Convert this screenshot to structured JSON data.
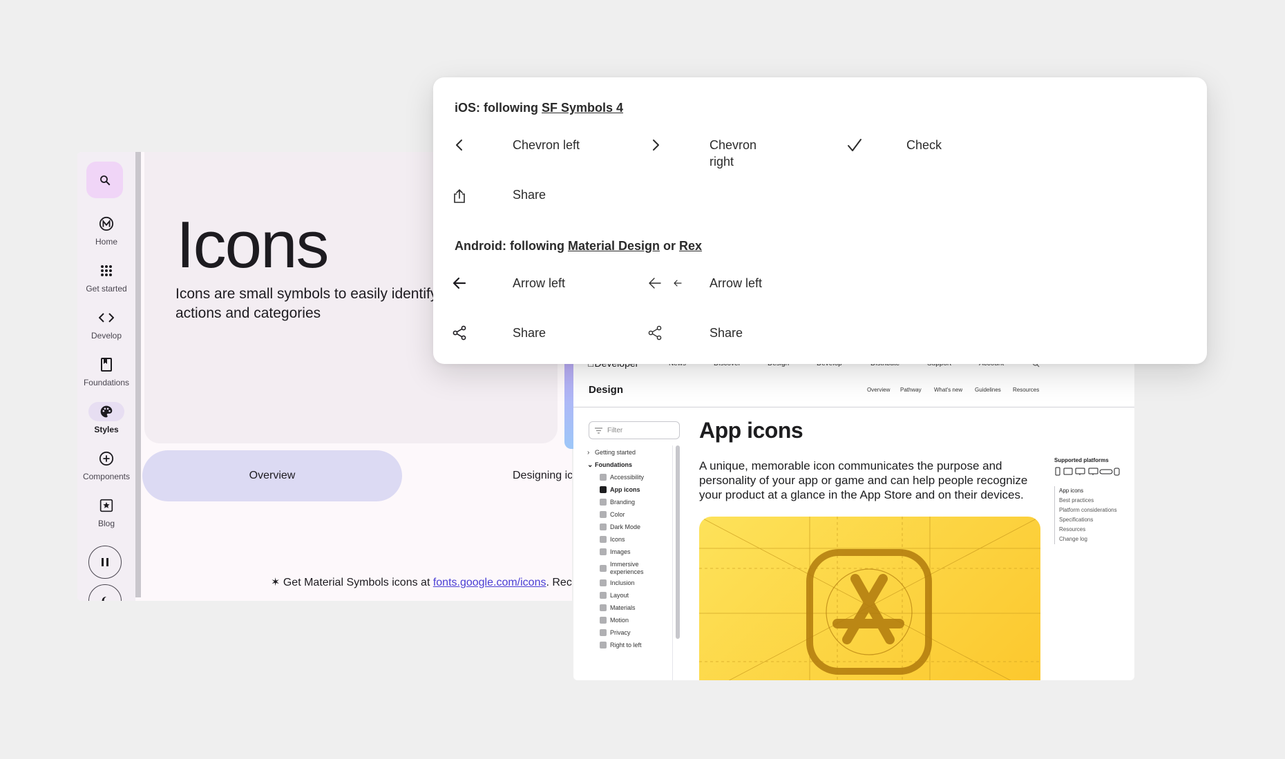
{
  "material": {
    "rail": {
      "items": [
        {
          "label": "Home",
          "icon": "material-logo-icon"
        },
        {
          "label": "Get started",
          "icon": "apps-grid-icon"
        },
        {
          "label": "Develop",
          "icon": "code-icon"
        },
        {
          "label": "Foundations",
          "icon": "book-icon"
        },
        {
          "label": "Styles",
          "icon": "palette-icon",
          "active": true
        },
        {
          "label": "Components",
          "icon": "add-circle-icon"
        },
        {
          "label": "Blog",
          "icon": "star-square-icon"
        }
      ]
    },
    "hero": {
      "title": "Icons",
      "description": "Icons are small symbols to easily identify actions and categories"
    },
    "tabs": [
      "Overview",
      "Designing icons"
    ],
    "footnote": {
      "prefix": "Get Material Symbols icons at ",
      "link": "fonts.google.com/icons",
      "suffix": ". Recommended"
    }
  },
  "card": {
    "ios": {
      "heading_prefix": "iOS: following ",
      "heading_link": "SF Symbols 4",
      "items": [
        {
          "icon": "chevron-left-icon",
          "label": "Chevron left"
        },
        {
          "icon": "chevron-right-icon",
          "label": "Chevron right"
        },
        {
          "icon": "check-icon",
          "label": "Check"
        },
        {
          "icon": "share-ios-icon",
          "label": "Share"
        }
      ]
    },
    "android": {
      "heading_prefix": "Android: following ",
      "heading_link1": "Material Design",
      "heading_mid": " or ",
      "heading_link2": "Rex",
      "items": [
        {
          "icon": "arrow-left-icon",
          "label": "Arrow left"
        },
        {
          "icon": "arrow-left-icon",
          "label": "Arrow left"
        },
        {
          "icon": "share-android-icon",
          "label": "Share"
        },
        {
          "icon": "share-android-icon",
          "label": "Share"
        }
      ]
    }
  },
  "apple": {
    "logo": "Developer",
    "nav": [
      "News",
      "Discover",
      "Design",
      "Develop",
      "Distribute",
      "Support",
      "Account"
    ],
    "sub_title": "Design",
    "sub_nav": [
      "Overview",
      "Pathway",
      "What's new",
      "Guidelines",
      "Resources"
    ],
    "filter_placeholder": "Filter",
    "sidebar": [
      {
        "label": "Getting started",
        "type": "group"
      },
      {
        "label": "Foundations",
        "type": "group-open"
      },
      {
        "label": "Accessibility"
      },
      {
        "label": "App icons",
        "current": true
      },
      {
        "label": "Branding"
      },
      {
        "label": "Color"
      },
      {
        "label": "Dark Mode"
      },
      {
        "label": "Icons"
      },
      {
        "label": "Images"
      },
      {
        "label": "Immersive experiences"
      },
      {
        "label": "Inclusion"
      },
      {
        "label": "Layout"
      },
      {
        "label": "Materials"
      },
      {
        "label": "Motion"
      },
      {
        "label": "Privacy"
      },
      {
        "label": "Right to left"
      }
    ],
    "title": "App icons",
    "intro": "A unique, memorable icon communicates the purpose and personality of your app or game and can help people recognize your product at a glance in the App Store and on their devices.",
    "platforms_heading": "Supported platforms",
    "toc": [
      "App icons",
      "Best practices",
      "Platform considerations",
      "Specifications",
      "Resources",
      "Change log"
    ],
    "accent": "#fcd33c"
  }
}
